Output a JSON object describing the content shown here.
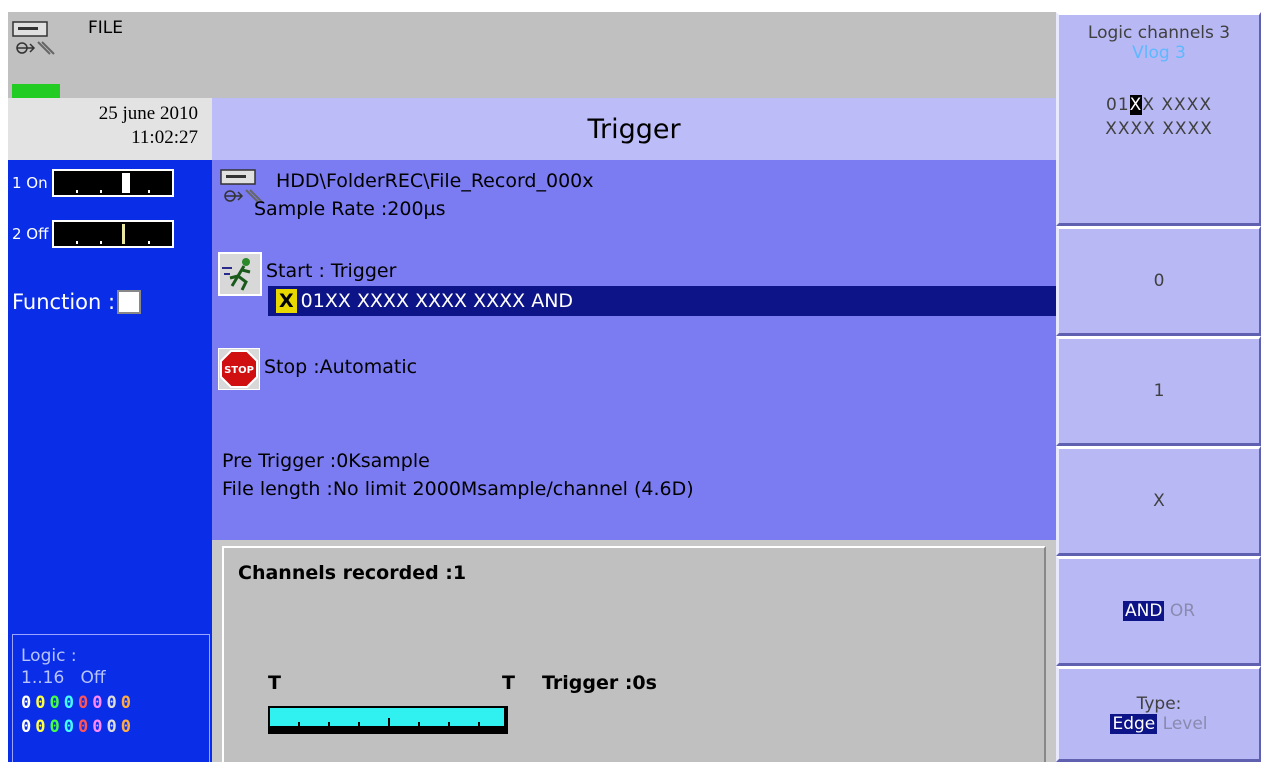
{
  "status": {
    "file_label": "FILE",
    "date": "25 june 2010",
    "time": "11:02:27",
    "led_color": "#22cc22",
    "icon": "hdd-usb-icon"
  },
  "channels": [
    {
      "label": "1 On"
    },
    {
      "label": "2 Off"
    }
  ],
  "function_label": "Function :",
  "logic_panel": {
    "title": "Logic :",
    "range": "1..16",
    "state": "Off",
    "row1": [
      "0",
      "0",
      "0",
      "0",
      "0",
      "0",
      "0",
      "0"
    ],
    "row2": [
      "0",
      "0",
      "0",
      "0",
      "0",
      "0",
      "0",
      "0"
    ],
    "row1_colors": [
      "#ffffff",
      "#ffff44",
      "#44ff44",
      "#44ffff",
      "#ff5555",
      "#ff88ff",
      "#dddddd",
      "#ffaa44"
    ],
    "row2_colors": [
      "#ffffff",
      "#ffff44",
      "#44ff44",
      "#44ffff",
      "#ff5555",
      "#ff88ff",
      "#dddddd",
      "#ffaa44"
    ]
  },
  "page_title": "Trigger",
  "file_path": "HDD\\FolderREC\\File_Record_000x",
  "sample_rate": "Sample Rate :200µs",
  "start": {
    "label": "Start :  Trigger",
    "cond_box": "X",
    "condition": "01XX XXXX XXXX XXXX AND"
  },
  "stop": "Stop  :Automatic",
  "pre_trigger": "Pre Trigger :0Ksample",
  "file_length": "File length :No limit  2000Msample/channel  (4.6D)",
  "record": {
    "channels_recorded": "Channels recorded :1",
    "t_left": "T",
    "t_right": "T",
    "trigger_time": "Trigger :0s"
  },
  "softkeys": {
    "logic_title": "Logic channels  3",
    "logic_sub": "Vlog  3",
    "pattern_pre": "01",
    "pattern_hl": "X",
    "pattern_post": "X  XXXX",
    "pattern_line2": "XXXX  XXXX",
    "key_0": "0",
    "key_1": "1",
    "key_x": "X",
    "and_label": "AND",
    "or_label": "OR",
    "type_label": "Type:",
    "edge_label": "Edge",
    "level_label": "Level"
  }
}
